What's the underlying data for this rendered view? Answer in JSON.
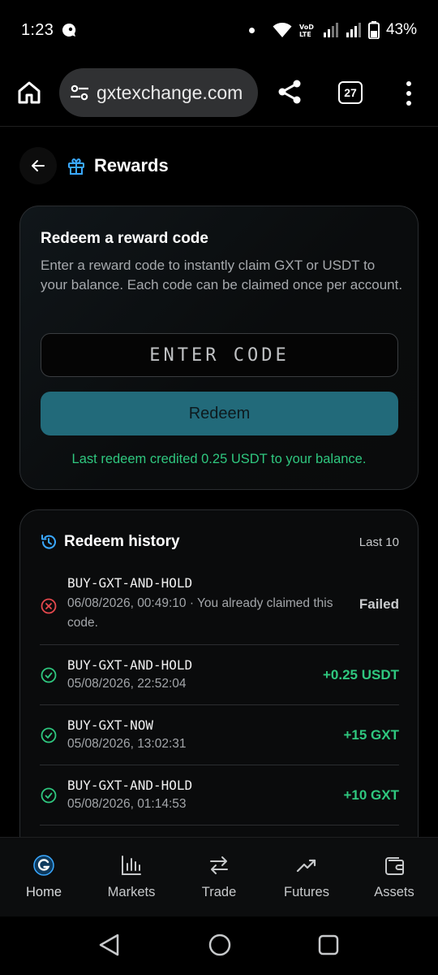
{
  "status": {
    "time": "1:23",
    "battery": "43%",
    "net": "VoD LTE"
  },
  "browser": {
    "url": "gxtexchange.com",
    "tab_count": "27"
  },
  "header": {
    "title": "Rewards"
  },
  "redeem": {
    "title": "Redeem a reward code",
    "description": "Enter a reward code to instantly claim GXT or USDT to your balance. Each code can be claimed once per account.",
    "input_placeholder": "ENTER CODE",
    "button_label": "Redeem",
    "last_note": "Last redeem credited 0.25 USDT to your balance."
  },
  "history": {
    "title": "Redeem history",
    "count_label": "Last 10",
    "rows": [
      {
        "code": "BUY-GXT-AND-HOLD",
        "detail": "06/08/2026, 00:49:10 · You already claimed this code.",
        "amount": "Failed",
        "status": "failed"
      },
      {
        "code": "BUY-GXT-AND-HOLD",
        "detail": "05/08/2026, 22:52:04",
        "amount": "+0.25 USDT",
        "status": "success"
      },
      {
        "code": "BUY-GXT-NOW",
        "detail": "05/08/2026, 13:02:31",
        "amount": "+15 GXT",
        "status": "success"
      },
      {
        "code": "BUY-GXT-AND-HOLD",
        "detail": "05/08/2026, 01:14:53",
        "amount": "+10 GXT",
        "status": "success"
      }
    ]
  },
  "nav": {
    "items": [
      {
        "label": "Home",
        "icon": "gxt-logo-icon"
      },
      {
        "label": "Markets",
        "icon": "bar-chart-icon"
      },
      {
        "label": "Trade",
        "icon": "swap-arrows-icon"
      },
      {
        "label": "Futures",
        "icon": "trending-up-icon"
      },
      {
        "label": "Assets",
        "icon": "wallet-icon"
      }
    ]
  },
  "colors": {
    "accent": "#226a7a",
    "success": "#2fc77f",
    "error": "#e5484d",
    "brand": "#3aa8ff"
  }
}
